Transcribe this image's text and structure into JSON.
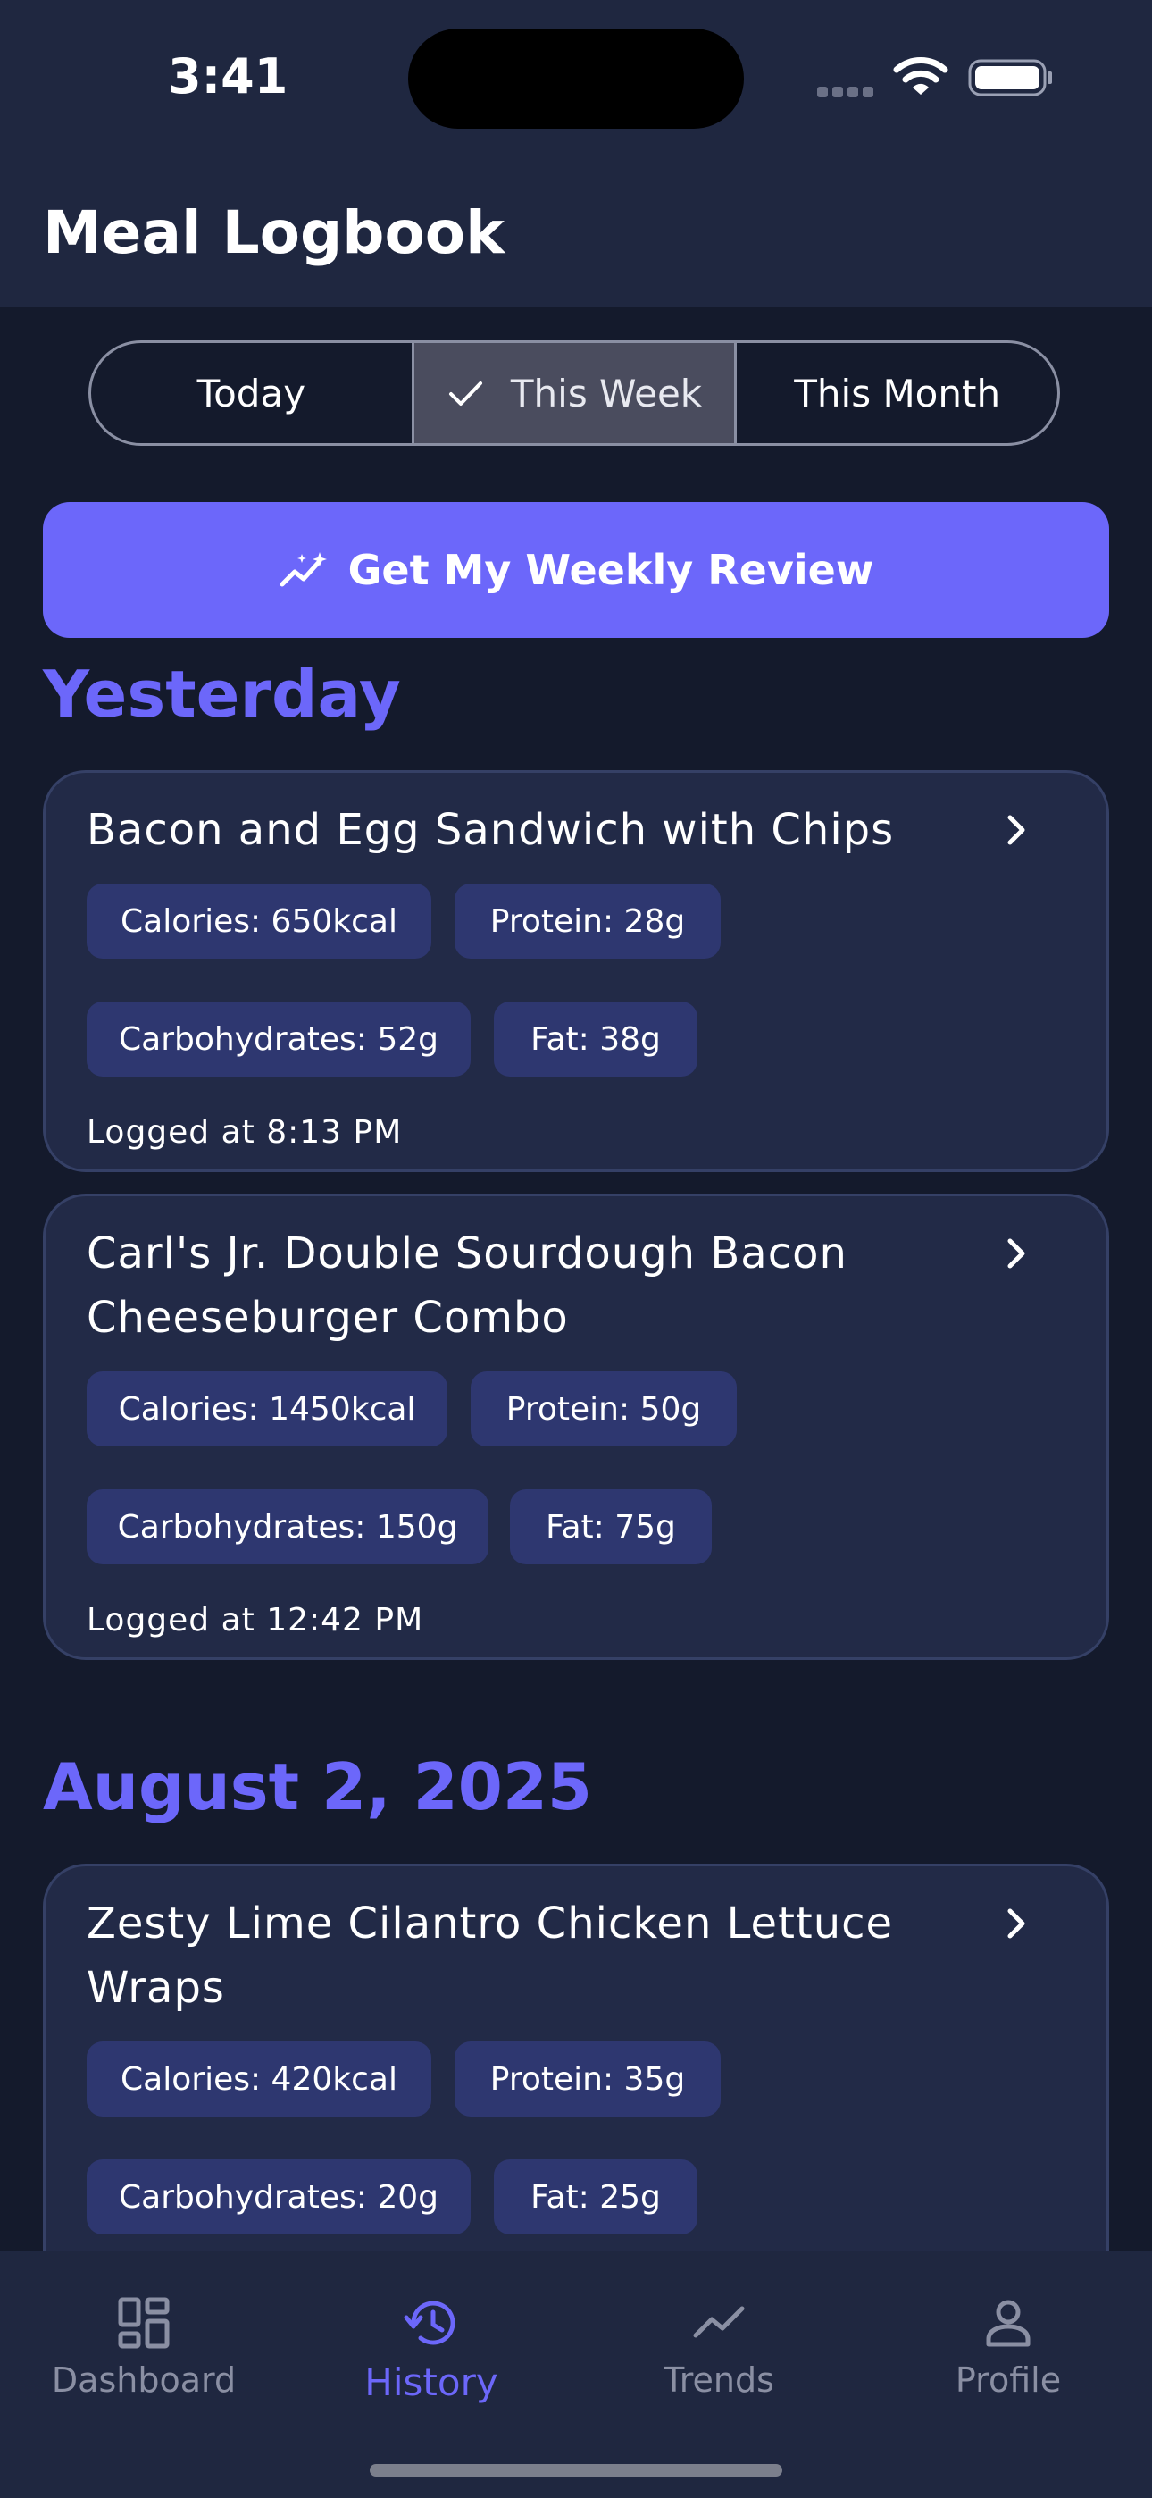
{
  "status_bar": {
    "time": "3:41"
  },
  "header": {
    "title": "Meal Logbook"
  },
  "filters": {
    "tabs": [
      "Today",
      "This Week",
      "This Month"
    ],
    "selected": "This Week"
  },
  "review_button": {
    "label": "Get My Weekly Review"
  },
  "sections": [
    {
      "heading": "Yesterday",
      "meals": [
        {
          "name": "Bacon and Egg Sandwich with Chips",
          "calories": "Calories: 650kcal",
          "protein": "Protein: 28g",
          "carbs": "Carbohydrates: 52g",
          "fat": "Fat: 38g",
          "logged": "Logged at 8:13 PM"
        },
        {
          "name": "Carl's Jr. Double Sourdough Bacon Cheeseburger Combo",
          "calories": "Calories: 1450kcal",
          "protein": "Protein: 50g",
          "carbs": "Carbohydrates: 150g",
          "fat": "Fat: 75g",
          "logged": "Logged at 12:42 PM"
        }
      ]
    },
    {
      "heading": "August 2, 2025",
      "meals": [
        {
          "name": "Zesty Lime Cilantro Chicken Lettuce Wraps",
          "calories": "Calories: 420kcal",
          "protein": "Protein: 35g",
          "carbs": "Carbohydrates: 20g",
          "fat": "Fat: 25g"
        }
      ]
    }
  ],
  "bottom_nav": {
    "items": [
      {
        "label": "Dashboard",
        "icon": "dashboard-icon"
      },
      {
        "label": "History",
        "icon": "history-icon"
      },
      {
        "label": "Trends",
        "icon": "trends-icon"
      },
      {
        "label": "Profile",
        "icon": "profile-icon"
      }
    ],
    "active": "History"
  },
  "colors": {
    "accent": "#6c67fa",
    "background": "#141a2c",
    "card": "#222a47",
    "chip": "#2e3770",
    "header": "#1f2740"
  }
}
